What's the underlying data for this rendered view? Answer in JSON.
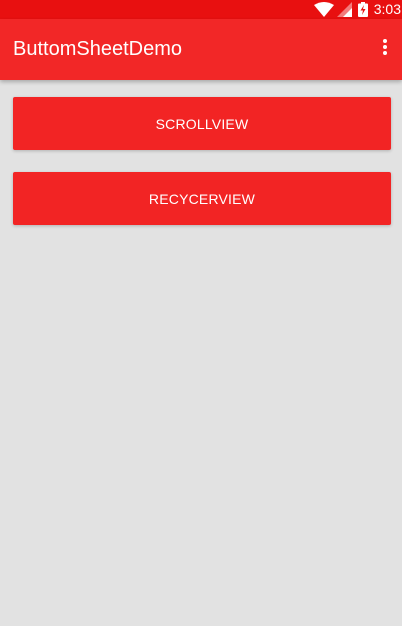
{
  "status_bar": {
    "time": "3:03",
    "icons": [
      "wifi-icon",
      "signal-icon",
      "battery-charging-icon"
    ]
  },
  "app_bar": {
    "title": "ButtomSheetDemo",
    "menu_icon": "overflow-menu-icon"
  },
  "buttons": {
    "scrollview_label": "SCROLLVIEW",
    "recyclerview_label": "RECYCERVIEW"
  },
  "colors": {
    "status_bar": "#e81010",
    "app_bar": "#f22727",
    "button": "#f22424",
    "background": "#e2e2e2",
    "text_on_primary": "#ffffff"
  }
}
